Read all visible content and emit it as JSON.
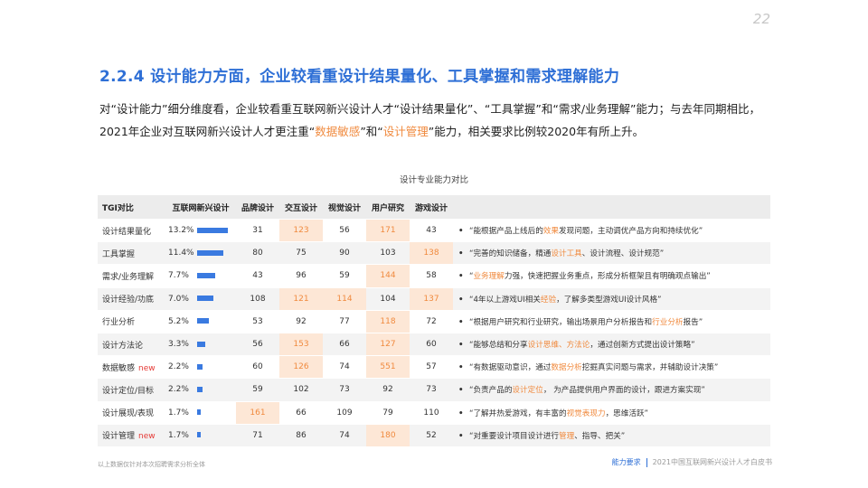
{
  "page_number": "22",
  "title": "2.2.4 设计能力方面，企业较看重设计结果量化、工具掌握和需求理解能力",
  "intro": [
    {
      "t": "对“设计能力”细分维度看，企业较看重互联网新兴设计人才“设计结果量化”、“工具掌握”和“需求/业务理解”能力；与去年同期相比，2021年企业对互联网新兴设计人才更注重“"
    },
    {
      "t": "数据敏感",
      "hl": true
    },
    {
      "t": "”和“"
    },
    {
      "t": "设计管理",
      "hl": true
    },
    {
      "t": "”能力，相关要求比例较2020年有所上升。"
    }
  ],
  "chart_caption": "设计专业能力对比",
  "table": {
    "headers": [
      "TGI对比",
      "互联网新兴设计",
      "品牌设计",
      "交互设计",
      "视觉设计",
      "用户研究",
      "游戏设计"
    ],
    "new_label": "new",
    "highlight_color": "#f08a3e",
    "bar_color": "#3a7ae0",
    "rows": [
      {
        "dim": "设计结果量化",
        "is_new": false,
        "tgi": "13.2%",
        "tgi_value": 13.2,
        "brand": "31",
        "interaction": "123",
        "visual": "56",
        "research": "171",
        "game": "43",
        "hl": [
          false,
          true,
          false,
          true,
          false
        ],
        "quote": [
          {
            "t": "“能根据产品上线后的"
          },
          {
            "t": "效果",
            "hl": true
          },
          {
            "t": "发现问题，主动调优产品方向和持续优化”"
          }
        ]
      },
      {
        "dim": "工具掌握",
        "is_new": false,
        "tgi": "11.4%",
        "tgi_value": 11.4,
        "brand": "80",
        "interaction": "75",
        "visual": "90",
        "research": "103",
        "game": "138",
        "hl": [
          false,
          false,
          false,
          false,
          true
        ],
        "quote": [
          {
            "t": "“完善的知识储备，精通"
          },
          {
            "t": "设计工具",
            "hl": true
          },
          {
            "t": "、设计流程、设计规范”"
          }
        ]
      },
      {
        "dim": "需求/业务理解",
        "is_new": false,
        "tgi": "7.7%",
        "tgi_value": 7.7,
        "brand": "43",
        "interaction": "96",
        "visual": "59",
        "research": "144",
        "game": "58",
        "hl": [
          false,
          false,
          false,
          true,
          false
        ],
        "quote": [
          {
            "t": "“"
          },
          {
            "t": "业务理解",
            "hl": true
          },
          {
            "t": "力强，快速把握业务重点，形成分析框架且有明确观点输出”"
          }
        ]
      },
      {
        "dim": "设计经验/功底",
        "is_new": false,
        "tgi": "7.0%",
        "tgi_value": 7.0,
        "brand": "108",
        "interaction": "121",
        "visual": "114",
        "research": "104",
        "game": "137",
        "hl": [
          false,
          true,
          true,
          false,
          true
        ],
        "quote": [
          {
            "t": "“4年以上游戏UI相关"
          },
          {
            "t": "经验",
            "hl": true
          },
          {
            "t": "，了解多类型游戏UI设计风格”"
          }
        ]
      },
      {
        "dim": "行业分析",
        "is_new": false,
        "tgi": "5.2%",
        "tgi_value": 5.2,
        "brand": "53",
        "interaction": "92",
        "visual": "77",
        "research": "118",
        "game": "72",
        "hl": [
          false,
          false,
          false,
          true,
          false
        ],
        "quote": [
          {
            "t": "“根据用户研究和行业研究，输出场景用户分析报告和"
          },
          {
            "t": "行业分析",
            "hl": true
          },
          {
            "t": "报告”"
          }
        ]
      },
      {
        "dim": "设计方法论",
        "is_new": false,
        "tgi": "3.3%",
        "tgi_value": 3.3,
        "brand": "56",
        "interaction": "153",
        "visual": "66",
        "research": "127",
        "game": "60",
        "hl": [
          false,
          true,
          false,
          true,
          false
        ],
        "quote": [
          {
            "t": "“能够总结和分享"
          },
          {
            "t": "设计思维、方法论",
            "hl": true
          },
          {
            "t": "，通过创新方式提出设计策略”"
          }
        ]
      },
      {
        "dim": "数据敏感",
        "is_new": true,
        "tgi": "2.2%",
        "tgi_value": 2.2,
        "brand": "60",
        "interaction": "126",
        "visual": "74",
        "research": "551",
        "game": "57",
        "hl": [
          false,
          true,
          false,
          true,
          false
        ],
        "quote": [
          {
            "t": "“有数据驱动意识，通过"
          },
          {
            "t": "数据分析",
            "hl": true
          },
          {
            "t": "挖掘真实问题与需求，并辅助设计决策”"
          }
        ]
      },
      {
        "dim": "设计定位/目标",
        "is_new": false,
        "tgi": "2.2%",
        "tgi_value": 2.2,
        "brand": "59",
        "interaction": "102",
        "visual": "73",
        "research": "92",
        "game": "73",
        "hl": [
          false,
          false,
          false,
          false,
          false
        ],
        "quote": [
          {
            "t": "“负责产品的"
          },
          {
            "t": "设计定位",
            "hl": true
          },
          {
            "t": "， 为产品提供用户界面的设计，跟进方案实现”"
          }
        ]
      },
      {
        "dim": "设计展现/表现",
        "is_new": false,
        "tgi": "1.7%",
        "tgi_value": 1.7,
        "brand": "161",
        "interaction": "66",
        "visual": "109",
        "research": "79",
        "game": "110",
        "hl": [
          true,
          false,
          false,
          false,
          false
        ],
        "quote": [
          {
            "t": "“了解并热爱游戏，有丰富的"
          },
          {
            "t": "视觉表现力",
            "hl": true
          },
          {
            "t": "，思维活跃”"
          }
        ]
      },
      {
        "dim": "设计管理",
        "is_new": true,
        "tgi": "1.7%",
        "tgi_value": 1.7,
        "brand": "71",
        "interaction": "86",
        "visual": "74",
        "research": "180",
        "game": "52",
        "hl": [
          false,
          false,
          false,
          true,
          false
        ],
        "quote": [
          {
            "t": "“对重要设计项目设计进行"
          },
          {
            "t": "管理",
            "hl": true
          },
          {
            "t": "、指导、把关”"
          }
        ]
      }
    ]
  },
  "footer": {
    "note": "以上数据仅针对本次招聘需求分析全体",
    "tag": "能力要求",
    "report": "2021中国互联网新兴设计人才白皮书"
  }
}
